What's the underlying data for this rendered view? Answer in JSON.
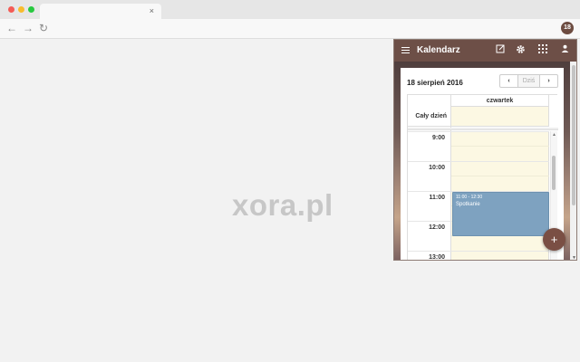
{
  "browser": {
    "tab_close": "×",
    "back_icon": "←",
    "forward_icon": "→",
    "reload_icon": "↻",
    "extension_label": "18"
  },
  "page": {
    "watermark": "xora.pl"
  },
  "calendar": {
    "app_title": "Kalendarz",
    "date_label": "18 sierpień 2016",
    "prev_label": "‹",
    "today_label": "Dziś",
    "next_label": "›",
    "day_header": "czwartek",
    "all_day_label": "Cały dzień",
    "time_slots": [
      "9:00",
      "10:00",
      "11:00",
      "12:00",
      "13:00"
    ],
    "event": {
      "time": "11:00 - 12:30",
      "title": "Spotkanie"
    },
    "fab_label": "+"
  }
}
